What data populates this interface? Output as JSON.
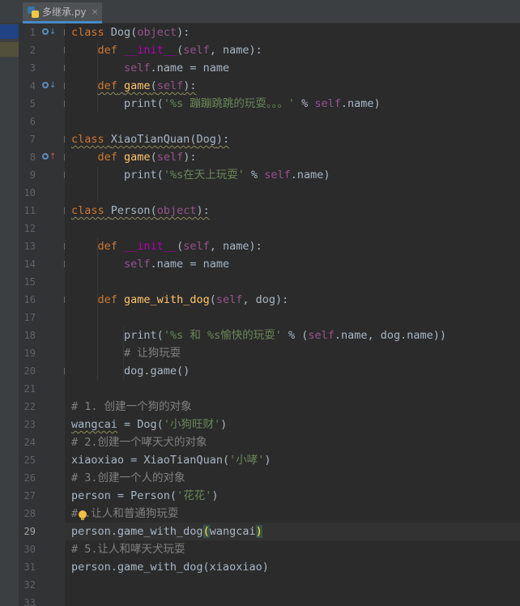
{
  "tab": {
    "label": "多继承.py",
    "close": "×"
  },
  "line_numbers": [
    "1",
    "2",
    "3",
    "4",
    "5",
    "6",
    "7",
    "8",
    "9",
    "10",
    "11",
    "12",
    "13",
    "14",
    "15",
    "16",
    "17",
    "18",
    "19",
    "20",
    "21",
    "22",
    "23",
    "24",
    "25",
    "26",
    "27",
    "28",
    "29",
    "30",
    "31",
    "32",
    "33"
  ],
  "current_line": "29",
  "code": {
    "l1": {
      "kw": "class",
      "name": "Dog",
      "lp": "(",
      "base": "object",
      "rp": "):"
    },
    "l2": {
      "kw": "def",
      "name": "__init__",
      "lp": "(",
      "self": "self",
      "rest": ", name):"
    },
    "l3": {
      "self": "self",
      "rest": ".name = name"
    },
    "l4": {
      "kw": "def",
      "name": "game",
      "lp": "(",
      "self": "self",
      "rp": "):"
    },
    "l5": {
      "fn": "print(",
      "str": "'%s 蹦蹦跳跳的玩耍。。。'",
      "op": " % ",
      "self": "self",
      "rest": ".name)"
    },
    "l7": {
      "kw": "class",
      "name": "XiaoTianQuan",
      "lp": "(",
      "base": "Dog",
      "rp": "):"
    },
    "l8": {
      "kw": "def",
      "name": "game",
      "lp": "(",
      "self": "self",
      "rp": "):"
    },
    "l9": {
      "fn": "print(",
      "str": "'%s在天上玩耍'",
      "op": " % ",
      "self": "self",
      "rest": ".name)"
    },
    "l11": {
      "kw": "class",
      "name": "Person",
      "lp": "(",
      "base": "object",
      "rp": "):"
    },
    "l13": {
      "kw": "def",
      "name": "__init__",
      "lp": "(",
      "self": "self",
      "rest": ", name):"
    },
    "l14": {
      "self": "self",
      "rest": ".name = name"
    },
    "l16": {
      "kw": "def",
      "name": "game_with_dog",
      "lp": "(",
      "self": "self",
      "rest": ", dog):"
    },
    "l18": {
      "fn": "print(",
      "str": "'%s 和 %s愉快的玩耍'",
      "op": " % (",
      "self": "self",
      "rest": ".name, dog.name))"
    },
    "l19": {
      "cmt": "# 让狗玩耍"
    },
    "l20": {
      "text": "dog.game()"
    },
    "l22": {
      "cmt": "# 1. 创建一个狗的对象"
    },
    "l23": {
      "var": "wangcai",
      "eq": " = Dog(",
      "str": "'小狗旺财'",
      "rp": ")"
    },
    "l24": {
      "cmt": "# 2.创建一个哮天犬的对象"
    },
    "l25": {
      "var": "xiaoxiao",
      "eq": " = XiaoTianQuan(",
      "str": "'小哮'",
      "rp": ")"
    },
    "l26": {
      "cmt": "# 3.创建一个人的对象"
    },
    "l27": {
      "var": "person",
      "eq": " = Person(",
      "str": "'花花'",
      "rp": ")"
    },
    "l28": {
      "cmt_a": "#",
      "cmt_b": " .让人和普通狗玩耍"
    },
    "l29": {
      "a": "person.game_with_dog",
      "lp": "(",
      "arg": "wangcai",
      "rp": ")"
    },
    "l30": {
      "cmt": "# 5.让人和哮天犬玩耍"
    },
    "l31": {
      "text": "person.game_with_dog(xiaoxiao)"
    }
  },
  "colors": {
    "background": "#2b2b2b",
    "keyword": "#cc7832",
    "self": "#94558d",
    "string": "#6a8759",
    "comment": "#808080",
    "magic_method": "#b200b2",
    "function_name": "#ffc66d",
    "default_text": "#a9b7c6"
  },
  "icons": [
    "python-file-icon",
    "close-icon",
    "override-icon",
    "implemented-icon",
    "fold-icon",
    "intention-bulb-icon",
    "collapse-icon"
  ]
}
